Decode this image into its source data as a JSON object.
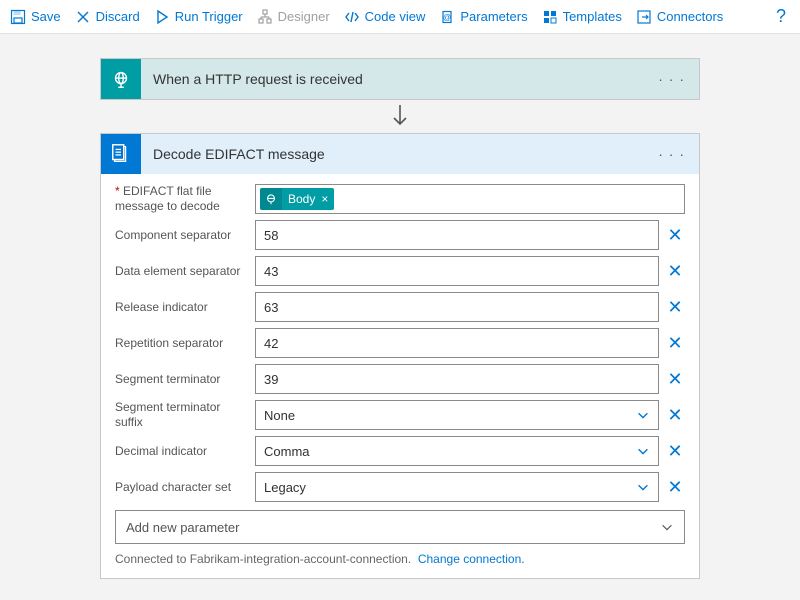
{
  "toolbar": {
    "save": "Save",
    "discard": "Discard",
    "run_trigger": "Run Trigger",
    "designer": "Designer",
    "code_view": "Code view",
    "parameters": "Parameters",
    "templates": "Templates",
    "connectors": "Connectors"
  },
  "trigger": {
    "title": "When a HTTP request is received"
  },
  "action": {
    "title": "Decode EDIFACT message",
    "token_field_label": "EDIFACT flat file message to decode",
    "token_value": "Body",
    "fields": {
      "component_separator": {
        "label": "Component separator",
        "value": "58"
      },
      "data_element_separator": {
        "label": "Data element separator",
        "value": "43"
      },
      "release_indicator": {
        "label": "Release indicator",
        "value": "63"
      },
      "repetition_separator": {
        "label": "Repetition separator",
        "value": "42"
      },
      "segment_terminator": {
        "label": "Segment terminator",
        "value": "39"
      },
      "segment_terminator_suffix": {
        "label": "Segment terminator suffix",
        "value": "None"
      },
      "decimal_indicator": {
        "label": "Decimal indicator",
        "value": "Comma"
      },
      "payload_character_set": {
        "label": "Payload character set",
        "value": "Legacy"
      }
    },
    "add_parameter": "Add new parameter",
    "connection_text": "Connected to Fabrikam-integration-account-connection.",
    "change_connection": "Change connection."
  }
}
